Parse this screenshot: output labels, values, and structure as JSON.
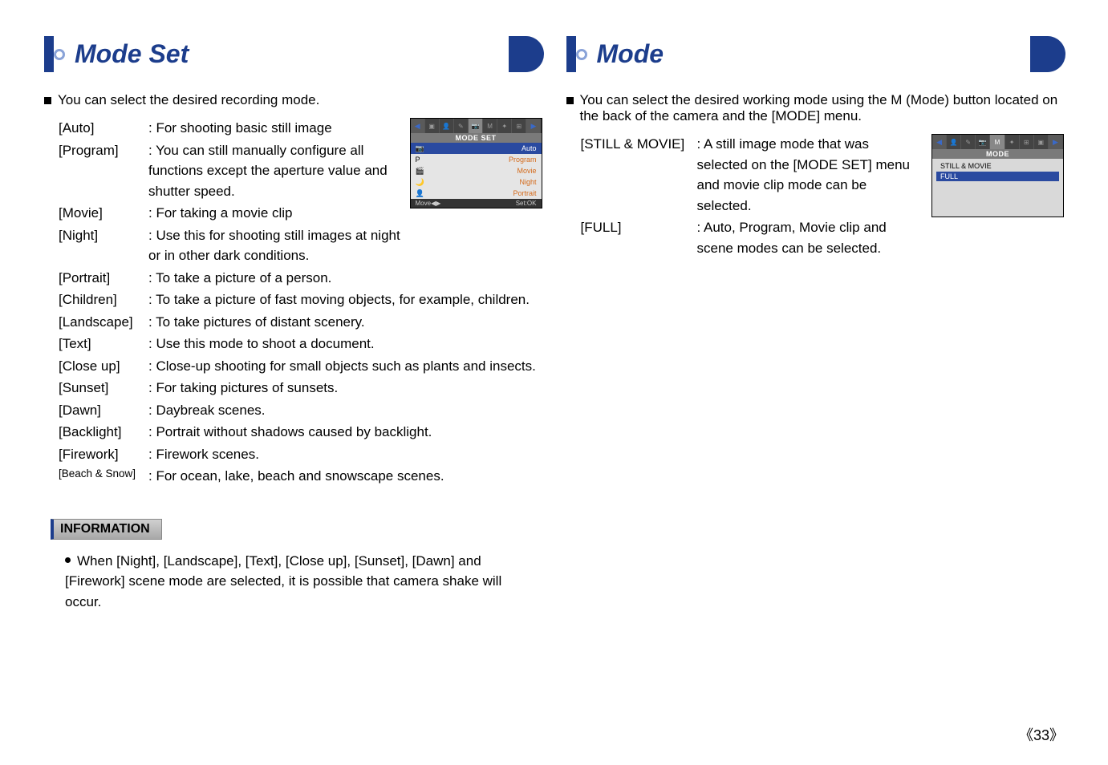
{
  "left": {
    "title": "Mode Set",
    "intro": "You can select the desired recording mode.",
    "modes": [
      {
        "label": "[Auto]",
        "desc": ": For shooting basic still image"
      },
      {
        "label": "[Program]",
        "desc": ": You can still manually configure all functions except the aperture value and shutter speed."
      },
      {
        "label": "[Movie]",
        "desc": ": For taking a movie clip"
      },
      {
        "label": "[Night]",
        "desc": ": Use this for shooting still images at night or in other dark conditions."
      },
      {
        "label": "[Portrait]",
        "desc": ": To take a picture of a person."
      },
      {
        "label": "[Children]",
        "desc": ": To take a picture of fast moving objects, for example, children."
      },
      {
        "label": "[Landscape]",
        "desc": ": To take pictures of distant scenery."
      },
      {
        "label": "[Text]",
        "desc": ": Use this mode to shoot a document."
      },
      {
        "label": "[Close up]",
        "desc": ": Close-up shooting for small objects such as plants and insects."
      },
      {
        "label": "[Sunset]",
        "desc": ": For taking pictures of sunsets."
      },
      {
        "label": "[Dawn]",
        "desc": ": Daybreak scenes."
      },
      {
        "label": "[Backlight]",
        "desc": ": Portrait without shadows caused by backlight."
      },
      {
        "label": "[Firework]",
        "desc": ": Firework scenes."
      },
      {
        "label": "[Beach & Snow]",
        "desc": ": For ocean, lake, beach and snowscape scenes.",
        "small": true
      }
    ],
    "info_title": "INFORMATION",
    "info_text": "When [Night], [Landscape], [Text], [Close up], [Sunset], [Dawn] and [Firework] scene mode are selected, it is possible that camera shake will occur."
  },
  "right": {
    "title": "Mode",
    "intro": "You can select the desired working mode using the M (Mode) button located on the back of the camera and the [MODE] menu.",
    "modes": [
      {
        "label": "[STILL & MOVIE]",
        "desc": ": A still image mode that was selected on the [MODE SET] menu and movie clip mode can be selected."
      },
      {
        "label": "[FULL]",
        "desc": ": Auto, Program, Movie clip and scene modes can be selected."
      }
    ]
  },
  "menu1": {
    "title": "MODE SET",
    "items": [
      {
        "icon": "📷",
        "label": "Auto",
        "sel": true
      },
      {
        "icon": "P",
        "label": "Program"
      },
      {
        "icon": "🎬",
        "label": "Movie"
      },
      {
        "icon": "🌙",
        "label": "Night"
      },
      {
        "icon": "👤",
        "label": "Portrait"
      }
    ],
    "foot_left": "Move◀▶",
    "foot_right": "Set:OK"
  },
  "menu2": {
    "title": "MODE",
    "tab": "M",
    "items": [
      {
        "label": "STILL & MOVIE"
      },
      {
        "label": "FULL",
        "sel": true
      }
    ]
  },
  "page": "《33》"
}
